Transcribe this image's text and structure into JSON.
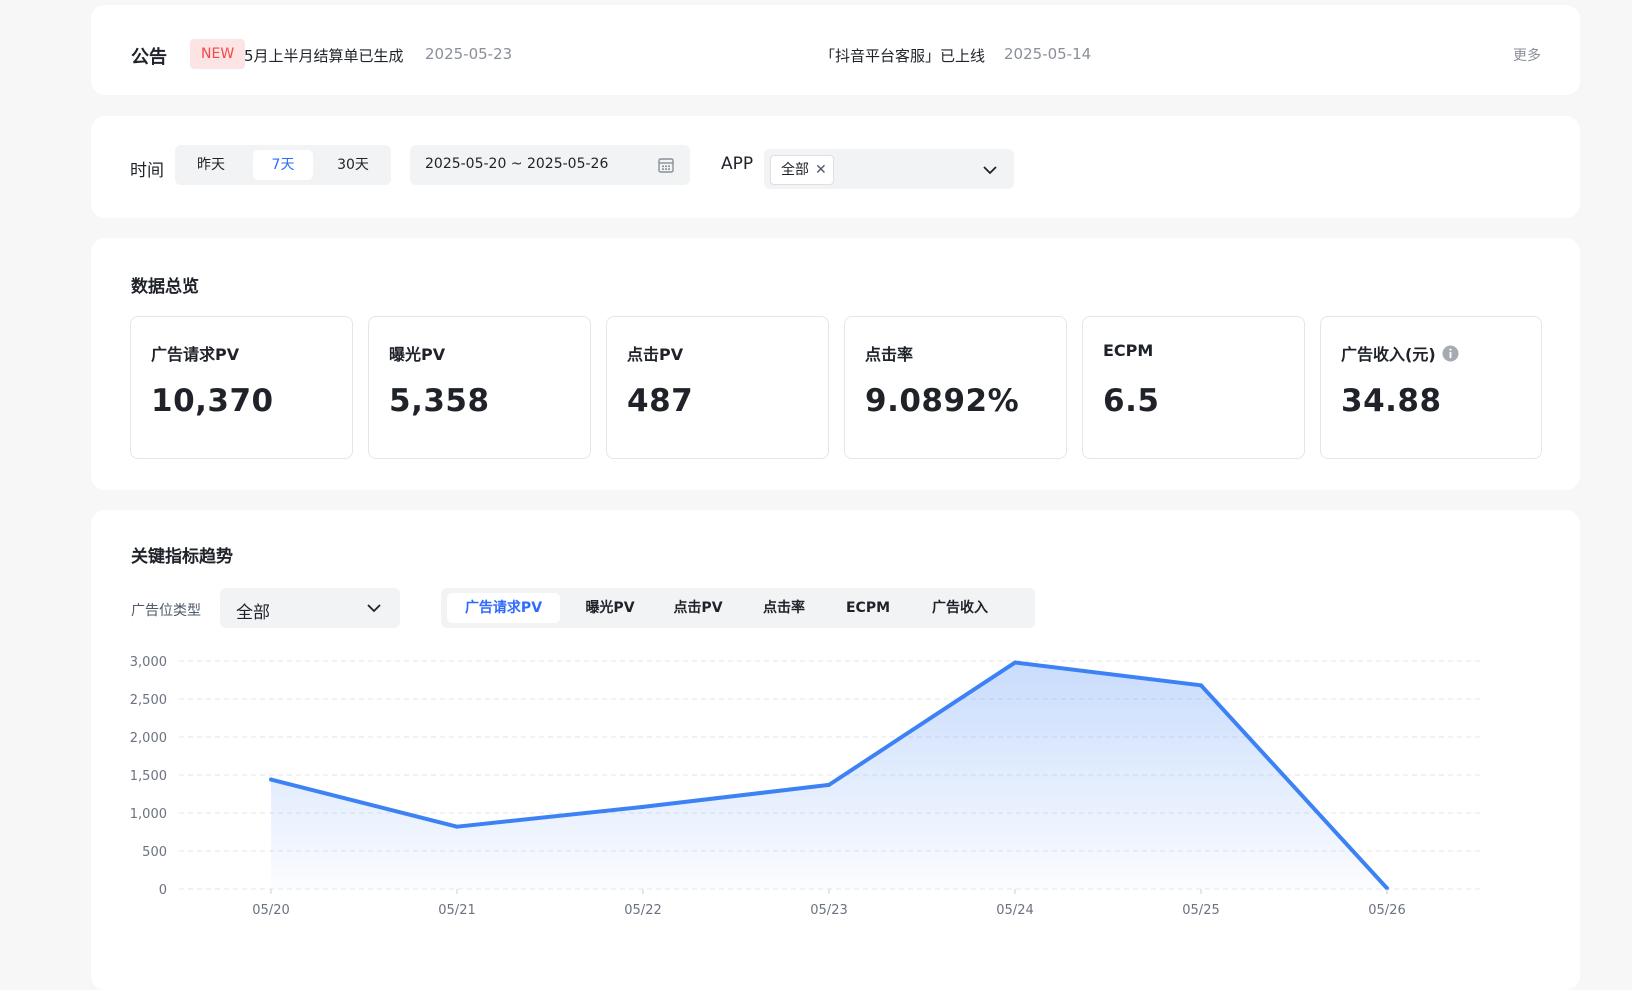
{
  "notice": {
    "title": "公告",
    "badge": "NEW",
    "item1_text": "5月上半月结算单已生成",
    "item1_date": "2025-05-23",
    "item2_text": "「抖音平台客服」已上线",
    "item2_date": "2025-05-14",
    "more": "更多"
  },
  "filters": {
    "time_label": "时间",
    "time_options": [
      "昨天",
      "7天",
      "30天"
    ],
    "time_selected": "7天",
    "date_range": "2025-05-20 ~ 2025-05-26",
    "app_label": "APP",
    "app_tag": "全部"
  },
  "overview": {
    "title": "数据总览",
    "kpis": [
      {
        "label": "广告请求PV",
        "value": "10,370"
      },
      {
        "label": "曝光PV",
        "value": "5,358"
      },
      {
        "label": "点击PV",
        "value": "487"
      },
      {
        "label": "点击率",
        "value": "9.0892%"
      },
      {
        "label": "ECPM",
        "value": "6.5"
      },
      {
        "label": "广告收入(元)",
        "value": "34.88"
      }
    ]
  },
  "trend": {
    "title": "关键指标趋势",
    "ad_type_label": "广告位类型",
    "ad_type_value": "全部",
    "metric_tabs": [
      "广告请求PV",
      "曝光PV",
      "点击PV",
      "点击率",
      "ECPM",
      "广告收入"
    ],
    "metric_selected": "广告请求PV"
  },
  "colors": {
    "accent": "#2f6bff",
    "line": "#3d82f5",
    "badge_bg": "#fde4e4",
    "badge_text": "#f04a4a"
  },
  "chart_data": {
    "type": "area",
    "categories": [
      "05/20",
      "05/21",
      "05/22",
      "05/23",
      "05/24",
      "05/25",
      "05/26"
    ],
    "series": [
      {
        "values": [
          1440,
          820,
          1080,
          1370,
          2980,
          2680,
          10
        ]
      }
    ],
    "yticks": [
      "3,000",
      "2,500",
      "2,000",
      "1,500",
      "1,000",
      "500",
      "0"
    ],
    "ylim": [
      0,
      3000
    ],
    "grid": true
  }
}
